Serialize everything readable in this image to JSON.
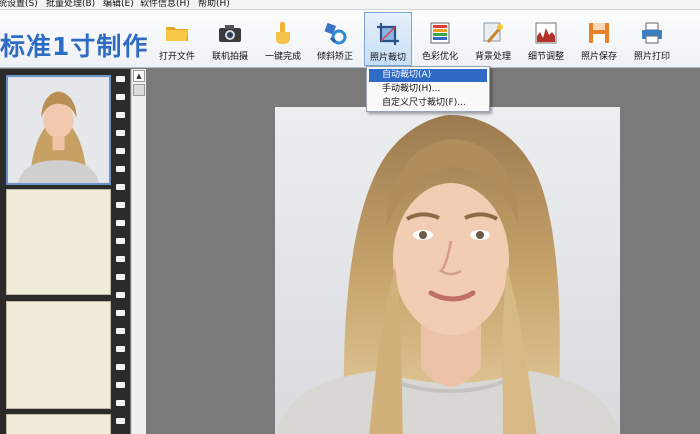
{
  "menu": {
    "items": [
      "统设置(S)",
      "批量处理(B)",
      "编辑(E)",
      "软件信息(H)",
      "帮助(H)"
    ]
  },
  "app": {
    "title": "标准1寸制作"
  },
  "toolbar": {
    "tools": [
      {
        "label": "打开文件",
        "icon": "folder-icon"
      },
      {
        "label": "联机拍摄",
        "icon": "camera-icon"
      },
      {
        "label": "一键完成",
        "icon": "hand-pointer-icon"
      },
      {
        "label": "倾斜矫正",
        "icon": "rotate-tool-icon"
      },
      {
        "label": "照片裁切",
        "icon": "crop-icon"
      },
      {
        "label": "色彩优化",
        "icon": "color-palette-icon"
      },
      {
        "label": "背景处理",
        "icon": "magic-wand-icon"
      },
      {
        "label": "细节调整",
        "icon": "histogram-icon"
      },
      {
        "label": "照片保存",
        "icon": "floppy-disk-icon"
      },
      {
        "label": "照片打印",
        "icon": "printer-icon"
      }
    ],
    "active_index": 4
  },
  "crop_menu": {
    "items": [
      "自动裁切(A)",
      "手动裁切(H)...",
      "自定义尺寸裁切(F)..."
    ],
    "highlighted_index": 0
  },
  "colors": {
    "title_blue": "#2d6cc2",
    "highlight_blue": "#2f6bc4",
    "film_strip": "#2b2b2b",
    "empty_frame": "#f1ecda",
    "workspace_gray": "#7a7a7a"
  }
}
